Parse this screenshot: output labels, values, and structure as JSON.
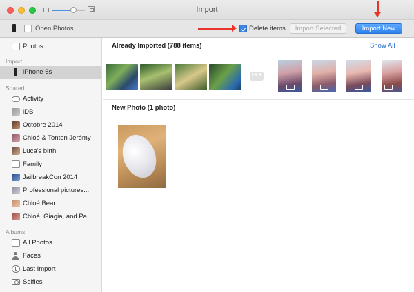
{
  "window": {
    "title": "Import"
  },
  "toolbar": {
    "open_photos_label": "Open Photos",
    "delete_items_label": "Delete items",
    "delete_items_checked": true,
    "import_selected_label": "Import Selected",
    "import_new_label": "Import New",
    "zoom_level": 0.65
  },
  "sidebar": {
    "photos_label": "Photos",
    "import_header": "Import",
    "device_label": "iPhone 6s",
    "shared_header": "Shared",
    "shared_items": [
      {
        "label": "Activity",
        "icon": "cloud-icon"
      },
      {
        "label": "iDB",
        "icon": "album-thumb-icon"
      },
      {
        "label": "Octobre 2014",
        "icon": "album-thumb-icon"
      },
      {
        "label": "Chloé & Tonton Jérémy",
        "icon": "album-thumb-icon"
      },
      {
        "label": "Luca's birth",
        "icon": "album-thumb-icon"
      },
      {
        "label": "Family",
        "icon": "album-thumb-icon"
      },
      {
        "label": "JailbreakCon 2014",
        "icon": "album-thumb-icon"
      },
      {
        "label": "Professional pictures...",
        "icon": "album-thumb-icon"
      },
      {
        "label": "Chloé Bear",
        "icon": "album-thumb-icon"
      },
      {
        "label": "Chloé, Giagia, and Pa...",
        "icon": "album-thumb-icon"
      }
    ],
    "albums_header": "Albums",
    "album_items": [
      {
        "label": "All Photos",
        "icon": "photos-icon"
      },
      {
        "label": "Faces",
        "icon": "person-icon"
      },
      {
        "label": "Last Import",
        "icon": "clock-icon"
      },
      {
        "label": "Selfies",
        "icon": "camera-icon"
      }
    ]
  },
  "main": {
    "already_imported_heading": "Already Imported (788 items)",
    "show_all_label": "Show All",
    "more_label": "•••",
    "new_photo_heading": "New Photo (1 photo)"
  },
  "colors": {
    "accent": "#2e82ee",
    "annotation_arrow": "#e8332b",
    "sidebar_selection": "#d3d3d3"
  }
}
